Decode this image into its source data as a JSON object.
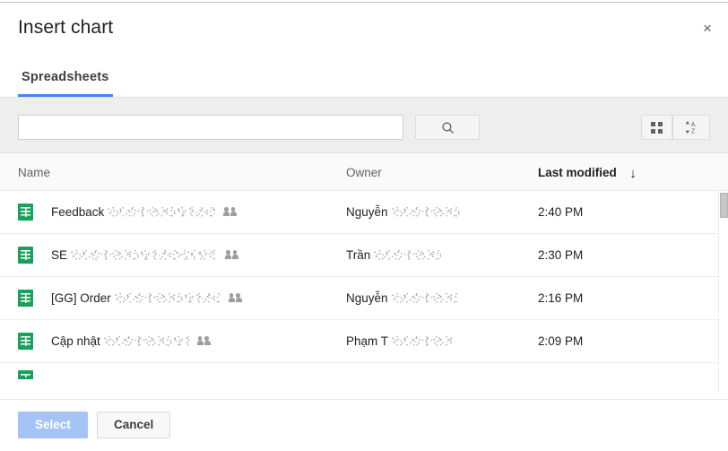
{
  "dialog": {
    "title": "Insert chart",
    "close_label": "×",
    "close_icon": "close-icon"
  },
  "tabs": [
    {
      "label": "Spreadsheets",
      "active": true
    }
  ],
  "toolbar": {
    "search_value": "",
    "search_placeholder": "",
    "search_button_icon": "search-icon",
    "grid_view_icon": "grid-view-icon",
    "sort_icon": "sort-az-icon",
    "sort_icon_label": "AZ"
  },
  "list": {
    "columns": {
      "name": "Name",
      "owner": "Owner",
      "last_modified": "Last modified",
      "sort_arrow": "↓",
      "sorted_by": "last_modified"
    },
    "rows": [
      {
        "file_icon": "google-sheets-icon",
        "name": "Feedback",
        "name_redacted": true,
        "shared": true,
        "owner": "Nguyễn",
        "owner_redacted": true,
        "last_modified": "2:40 PM"
      },
      {
        "file_icon": "google-sheets-icon",
        "name": "SE",
        "name_redacted": true,
        "shared": true,
        "owner": "Trần",
        "owner_redacted": true,
        "last_modified": "2:30 PM"
      },
      {
        "file_icon": "google-sheets-icon",
        "name": "[GG] Order",
        "name_redacted": true,
        "shared": true,
        "owner": "Nguyễn",
        "owner_redacted": true,
        "last_modified": "2:16 PM"
      },
      {
        "file_icon": "google-sheets-icon",
        "name": "Cập nhật",
        "name_redacted": true,
        "shared": true,
        "owner": "Phạm T",
        "owner_redacted": true,
        "last_modified": "2:09 PM"
      }
    ]
  },
  "footer": {
    "select_label": "Select",
    "select_disabled": true,
    "cancel_label": "Cancel"
  },
  "colors": {
    "accent_blue": "#4285f4",
    "select_disabled_blue": "#a5c4f5",
    "sheets_green": "#18a05c",
    "toolbar_gray": "#eeeeee",
    "header_row_gray": "#fafafa"
  }
}
